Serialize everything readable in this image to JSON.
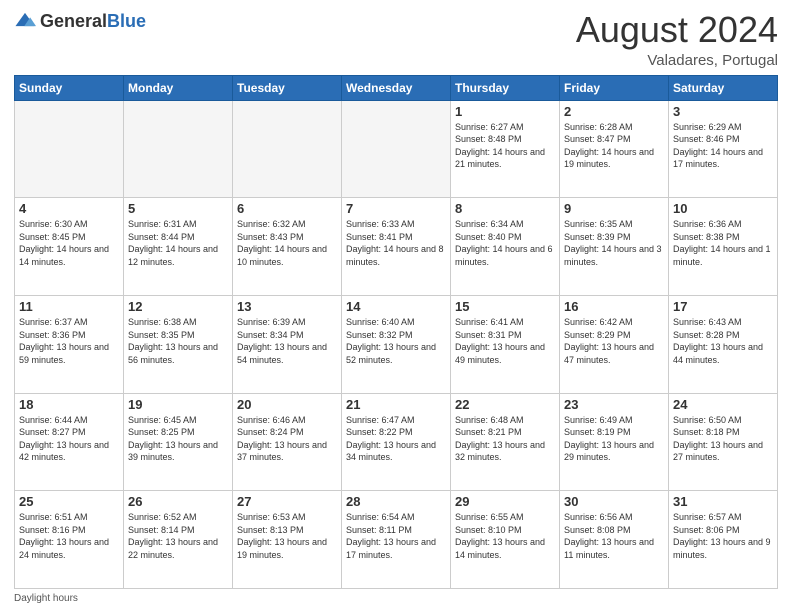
{
  "header": {
    "logo_general": "General",
    "logo_blue": "Blue",
    "month_year": "August 2024",
    "location": "Valadares, Portugal"
  },
  "weekdays": [
    "Sunday",
    "Monday",
    "Tuesday",
    "Wednesday",
    "Thursday",
    "Friday",
    "Saturday"
  ],
  "footer": {
    "daylight_label": "Daylight hours"
  },
  "weeks": [
    [
      {
        "day": "",
        "empty": true
      },
      {
        "day": "",
        "empty": true
      },
      {
        "day": "",
        "empty": true
      },
      {
        "day": "",
        "empty": true
      },
      {
        "day": "1",
        "sunrise": "6:27 AM",
        "sunset": "8:48 PM",
        "daylight": "14 hours and 21 minutes."
      },
      {
        "day": "2",
        "sunrise": "6:28 AM",
        "sunset": "8:47 PM",
        "daylight": "14 hours and 19 minutes."
      },
      {
        "day": "3",
        "sunrise": "6:29 AM",
        "sunset": "8:46 PM",
        "daylight": "14 hours and 17 minutes."
      }
    ],
    [
      {
        "day": "4",
        "sunrise": "6:30 AM",
        "sunset": "8:45 PM",
        "daylight": "14 hours and 14 minutes."
      },
      {
        "day": "5",
        "sunrise": "6:31 AM",
        "sunset": "8:44 PM",
        "daylight": "14 hours and 12 minutes."
      },
      {
        "day": "6",
        "sunrise": "6:32 AM",
        "sunset": "8:43 PM",
        "daylight": "14 hours and 10 minutes."
      },
      {
        "day": "7",
        "sunrise": "6:33 AM",
        "sunset": "8:41 PM",
        "daylight": "14 hours and 8 minutes."
      },
      {
        "day": "8",
        "sunrise": "6:34 AM",
        "sunset": "8:40 PM",
        "daylight": "14 hours and 6 minutes."
      },
      {
        "day": "9",
        "sunrise": "6:35 AM",
        "sunset": "8:39 PM",
        "daylight": "14 hours and 3 minutes."
      },
      {
        "day": "10",
        "sunrise": "6:36 AM",
        "sunset": "8:38 PM",
        "daylight": "14 hours and 1 minute."
      }
    ],
    [
      {
        "day": "11",
        "sunrise": "6:37 AM",
        "sunset": "8:36 PM",
        "daylight": "13 hours and 59 minutes."
      },
      {
        "day": "12",
        "sunrise": "6:38 AM",
        "sunset": "8:35 PM",
        "daylight": "13 hours and 56 minutes."
      },
      {
        "day": "13",
        "sunrise": "6:39 AM",
        "sunset": "8:34 PM",
        "daylight": "13 hours and 54 minutes."
      },
      {
        "day": "14",
        "sunrise": "6:40 AM",
        "sunset": "8:32 PM",
        "daylight": "13 hours and 52 minutes."
      },
      {
        "day": "15",
        "sunrise": "6:41 AM",
        "sunset": "8:31 PM",
        "daylight": "13 hours and 49 minutes."
      },
      {
        "day": "16",
        "sunrise": "6:42 AM",
        "sunset": "8:29 PM",
        "daylight": "13 hours and 47 minutes."
      },
      {
        "day": "17",
        "sunrise": "6:43 AM",
        "sunset": "8:28 PM",
        "daylight": "13 hours and 44 minutes."
      }
    ],
    [
      {
        "day": "18",
        "sunrise": "6:44 AM",
        "sunset": "8:27 PM",
        "daylight": "13 hours and 42 minutes."
      },
      {
        "day": "19",
        "sunrise": "6:45 AM",
        "sunset": "8:25 PM",
        "daylight": "13 hours and 39 minutes."
      },
      {
        "day": "20",
        "sunrise": "6:46 AM",
        "sunset": "8:24 PM",
        "daylight": "13 hours and 37 minutes."
      },
      {
        "day": "21",
        "sunrise": "6:47 AM",
        "sunset": "8:22 PM",
        "daylight": "13 hours and 34 minutes."
      },
      {
        "day": "22",
        "sunrise": "6:48 AM",
        "sunset": "8:21 PM",
        "daylight": "13 hours and 32 minutes."
      },
      {
        "day": "23",
        "sunrise": "6:49 AM",
        "sunset": "8:19 PM",
        "daylight": "13 hours and 29 minutes."
      },
      {
        "day": "24",
        "sunrise": "6:50 AM",
        "sunset": "8:18 PM",
        "daylight": "13 hours and 27 minutes."
      }
    ],
    [
      {
        "day": "25",
        "sunrise": "6:51 AM",
        "sunset": "8:16 PM",
        "daylight": "13 hours and 24 minutes."
      },
      {
        "day": "26",
        "sunrise": "6:52 AM",
        "sunset": "8:14 PM",
        "daylight": "13 hours and 22 minutes."
      },
      {
        "day": "27",
        "sunrise": "6:53 AM",
        "sunset": "8:13 PM",
        "daylight": "13 hours and 19 minutes."
      },
      {
        "day": "28",
        "sunrise": "6:54 AM",
        "sunset": "8:11 PM",
        "daylight": "13 hours and 17 minutes."
      },
      {
        "day": "29",
        "sunrise": "6:55 AM",
        "sunset": "8:10 PM",
        "daylight": "13 hours and 14 minutes."
      },
      {
        "day": "30",
        "sunrise": "6:56 AM",
        "sunset": "8:08 PM",
        "daylight": "13 hours and 11 minutes."
      },
      {
        "day": "31",
        "sunrise": "6:57 AM",
        "sunset": "8:06 PM",
        "daylight": "13 hours and 9 minutes."
      }
    ]
  ]
}
